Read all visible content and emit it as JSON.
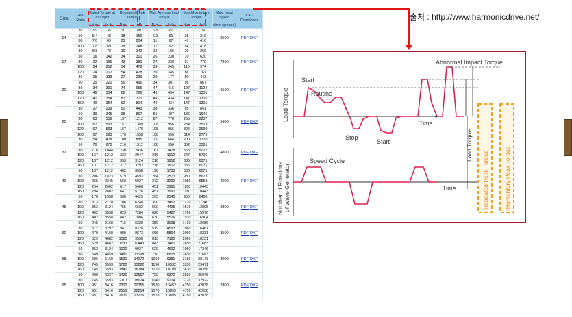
{
  "source_label": "출처 : http://www.harmonicdrive.net/",
  "table": {
    "headers": {
      "size": "Size",
      "gear_ratio": "Gear Ratio",
      "rated": "Rated Torque at 2000rpm",
      "repeated": "Repeated Peak Torque",
      "average": "Max.Average load Torque",
      "momentary": "Max.Momentary Torque",
      "max_input": "Max. Input Speed",
      "cad": "CAD Downloads",
      "nm": "N.m",
      "inlb": "In.lb",
      "rmin": "r/min (grease)"
    },
    "cad_pdf": "PDF",
    "cad_dxf": "DXF",
    "groups": [
      {
        "size": "14",
        "speed": "8500",
        "rows": [
          [
            "30",
            "3.9",
            "35",
            "9",
            "80",
            "6.8",
            "60",
            "17",
            "150"
          ],
          [
            "50",
            "5.4",
            "48",
            "18",
            "159",
            "6.9",
            "61",
            "35",
            "310"
          ],
          [
            "80",
            "7.8",
            "69",
            "23",
            "204",
            "11",
            "97",
            "47",
            "416"
          ],
          [
            "100",
            "7.8",
            "69",
            "28",
            "248",
            "11",
            "97",
            "54",
            "478"
          ]
        ]
      },
      {
        "size": "17",
        "speed": "7300",
        "rows": [
          [
            "30",
            "8.8",
            "78",
            "16",
            "142",
            "12",
            "106",
            "30",
            "266"
          ],
          [
            "50",
            "16",
            "142",
            "34",
            "301",
            "26",
            "230",
            "70",
            "620"
          ],
          [
            "80",
            "22",
            "195",
            "43",
            "381",
            "27",
            "239",
            "87",
            "770"
          ],
          [
            "100",
            "24",
            "212",
            "54",
            "478",
            "39",
            "345",
            "110",
            "974"
          ],
          [
            "120",
            "24",
            "212",
            "54",
            "478",
            "39",
            "345",
            "86",
            "761"
          ]
        ]
      },
      {
        "size": "20",
        "speed": "6500",
        "rows": [
          [
            "30",
            "15",
            "133",
            "27",
            "239",
            "20",
            "177",
            "50",
            "443"
          ],
          [
            "50",
            "25",
            "221",
            "56",
            "496",
            "34",
            "301",
            "98",
            "867"
          ],
          [
            "80",
            "34",
            "301",
            "74",
            "655",
            "47",
            "416",
            "127",
            "1124"
          ],
          [
            "100",
            "40",
            "354",
            "82",
            "726",
            "49",
            "434",
            "147",
            "1301"
          ],
          [
            "120",
            "40",
            "354",
            "87",
            "770",
            "49",
            "434",
            "147",
            "1301"
          ],
          [
            "160",
            "40",
            "354",
            "92",
            "814",
            "49",
            "434",
            "147",
            "1301"
          ]
        ]
      },
      {
        "size": "25",
        "speed": "5600",
        "rows": [
          [
            "30",
            "27",
            "239",
            "50",
            "443",
            "38",
            "336",
            "95",
            "841"
          ],
          [
            "50",
            "39",
            "345",
            "98",
            "867",
            "55",
            "487",
            "186",
            "1646"
          ],
          [
            "80",
            "63",
            "558",
            "137",
            "1212",
            "87",
            "770",
            "255",
            "2257"
          ],
          [
            "100",
            "67",
            "593",
            "157",
            "1389",
            "108",
            "956",
            "284",
            "2513"
          ],
          [
            "120",
            "67",
            "593",
            "167",
            "1478",
            "108",
            "956",
            "304",
            "2690"
          ],
          [
            "160",
            "67",
            "593",
            "176",
            "1558",
            "108",
            "956",
            "314",
            "2779"
          ]
        ]
      },
      {
        "size": "32",
        "speed": "4800",
        "rows": [
          [
            "30",
            "54",
            "478",
            "100",
            "885",
            "75",
            "664",
            "200",
            "1770"
          ],
          [
            "50",
            "76",
            "673",
            "216",
            "1912",
            "108",
            "956",
            "382",
            "3381"
          ],
          [
            "80",
            "118",
            "1044",
            "230",
            "2036",
            "167",
            "1478",
            "568",
            "5027"
          ],
          [
            "100",
            "137",
            "1212",
            "333",
            "2947",
            "216",
            "1912",
            "647",
            "5726"
          ],
          [
            "120",
            "137",
            "1212",
            "353",
            "3124",
            "216",
            "1912",
            "686",
            "6071"
          ],
          [
            "160",
            "137",
            "1212",
            "372",
            "3292",
            "216",
            "1912",
            "686",
            "6071"
          ]
        ]
      },
      {
        "size": "40",
        "speed": "4000",
        "rows": [
          [
            "50",
            "137",
            "1212",
            "402",
            "3558",
            "196",
            "1735",
            "686",
            "6071"
          ],
          [
            "80",
            "206",
            "1823",
            "519",
            "4593",
            "284",
            "2513",
            "980",
            "8673"
          ],
          [
            "100",
            "265",
            "2345",
            "568",
            "5027",
            "372",
            "3292",
            "1080",
            "9558"
          ],
          [
            "120",
            "294",
            "2602",
            "617",
            "5460",
            "451",
            "3991",
            "1180",
            "10443"
          ],
          [
            "160",
            "294",
            "2602",
            "647",
            "5726",
            "451",
            "3991",
            "1180",
            "10443"
          ]
        ]
      },
      {
        "size": "45",
        "speed": "3800",
        "rows": [
          [
            "50",
            "176",
            "1558",
            "500",
            "4425",
            "265",
            "2345",
            "950",
            "8408"
          ],
          [
            "80",
            "313",
            "2770",
            "706",
            "6248",
            "390",
            "3452",
            "1270",
            "11240"
          ],
          [
            "100",
            "353",
            "3124",
            "755",
            "6682",
            "500",
            "4425",
            "1570",
            "13895"
          ],
          [
            "120",
            "402",
            "3558",
            "823",
            "7284",
            "620",
            "5487",
            "1760",
            "15576"
          ],
          [
            "160",
            "402",
            "3558",
            "882",
            "7806",
            "630",
            "5576",
            "1910",
            "16904"
          ]
        ]
      },
      {
        "size": "50",
        "speed": "3500",
        "rows": [
          [
            "50",
            "245",
            "2168",
            "715",
            "6328",
            "350",
            "3098",
            "1430",
            "12656"
          ],
          [
            "80",
            "372",
            "3292",
            "941",
            "8328",
            "519",
            "4593",
            "1860",
            "16461"
          ],
          [
            "100",
            "470",
            "4160",
            "980",
            "8673",
            "666",
            "5894",
            "2060",
            "18231"
          ],
          [
            "120",
            "529",
            "4682",
            "1080",
            "9558",
            "813",
            "7195",
            "2060",
            "18231"
          ],
          [
            "160",
            "529",
            "4682",
            "1180",
            "10443",
            "843",
            "7461",
            "2450",
            "21683"
          ]
        ]
      },
      {
        "size": "58",
        "speed": "3000",
        "rows": [
          [
            "50",
            "353",
            "3124",
            "1020",
            "9027",
            "520",
            "4602",
            "1960",
            "17346"
          ],
          [
            "80",
            "549",
            "4859",
            "1480",
            "13098",
            "770",
            "6815",
            "2450",
            "21683"
          ],
          [
            "100",
            "696",
            "6160",
            "1590",
            "14072",
            "1060",
            "9381",
            "3180",
            "28143"
          ],
          [
            "120",
            "745",
            "6593",
            "1720",
            "15222",
            "1190",
            "10532",
            "3330",
            "29471"
          ],
          [
            "160",
            "745",
            "6593",
            "1840",
            "16284",
            "1210",
            "10709",
            "3430",
            "30356"
          ]
        ]
      },
      {
        "size": "65",
        "speed": "2800",
        "rows": [
          [
            "50",
            "490",
            "4337",
            "1420",
            "12567",
            "720",
            "6372",
            "2830",
            "25046"
          ],
          [
            "80",
            "745",
            "6593",
            "2110",
            "18674",
            "1040",
            "9204",
            "3720",
            "32922"
          ],
          [
            "100",
            "951",
            "8416",
            "2300",
            "20355",
            "1520",
            "13452",
            "4750",
            "42038"
          ],
          [
            "120",
            "951",
            "8416",
            "2510",
            "22214",
            "1570",
            "13895",
            "4750",
            "42038"
          ],
          [
            "160",
            "951",
            "8416",
            "2630",
            "23276",
            "1570",
            "13895",
            "4750",
            "42038"
          ]
        ]
      }
    ]
  },
  "diagram": {
    "abnormal_impact": "Abnormal Impact Torque",
    "start": "Start",
    "routine": "Routine",
    "stop": "Stop",
    "start2": "Start",
    "time": "Time",
    "time2": "Time",
    "load_torque": "Load Torque",
    "load_torque2": "Load Torque",
    "repeated_peak": "Repeated Peak Torque",
    "momentary_peak": "Momentary Peak Torque",
    "speed_cycle": "Speed Cycle",
    "rotations": "Number of Rotations",
    "wave_gen": "of Wave Generator",
    "colors": {
      "frame": "#9e1d2b",
      "curve": "#e02050",
      "highlight": "#f5a01a"
    }
  }
}
